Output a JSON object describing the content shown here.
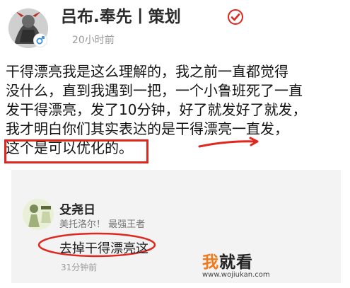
{
  "post": {
    "author": {
      "name": "吕布.奉先丨策划",
      "timestamp": "20小时前",
      "verified": true,
      "verified_color": "#e0271f"
    },
    "lines": [
      "干得漂亮我是这么理解的，我之前一直都觉得",
      "没什么，直到我遇到一把，一个小鲁班死了一直",
      "发干得漂亮，发了10分钟，好了就发好了就发，",
      "我才明白你们其实表达的是干得漂亮一直发，",
      "这个是可以优化的。"
    ],
    "highlight_color": "#e0271f"
  },
  "reply": {
    "name": "殳尧日",
    "tags": "美托洛尔！ 最强王者",
    "text": "去掉干得漂亮这",
    "timestamp": "31分钟前"
  },
  "watermark": {
    "main_left": "我",
    "main_right": "就看",
    "url": "www.wojiukan.com"
  },
  "colors": {
    "accent_red": "#e0271f",
    "meta_grey": "#9a9a9a",
    "card_bg": "#f3f3f3",
    "watermark_orange": "#f07a1a"
  }
}
